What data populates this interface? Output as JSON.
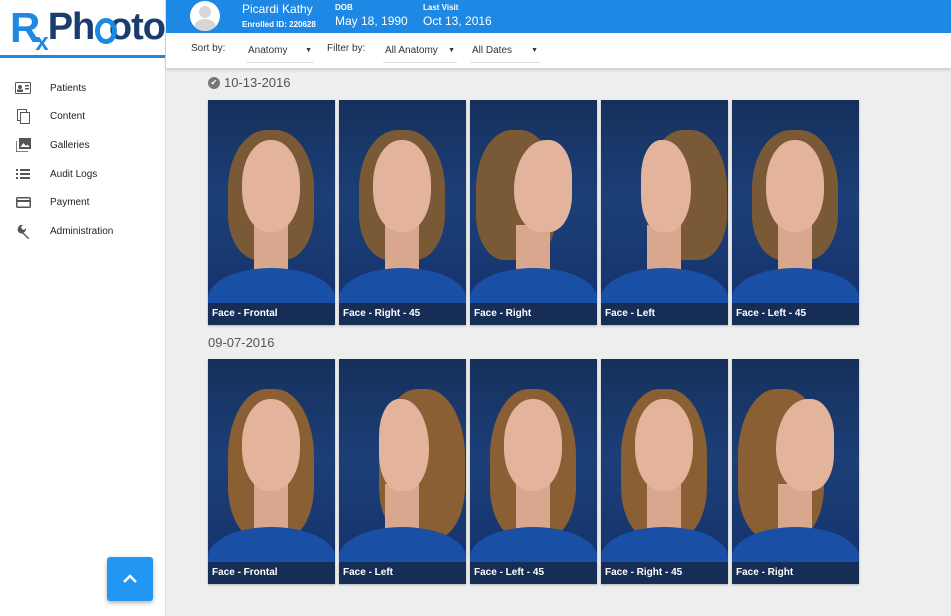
{
  "logo": {
    "rx": "R",
    "x": "x",
    "ph": "Ph",
    "oto": "oto"
  },
  "nav": [
    {
      "label": "Patients",
      "icon": "patients-icon"
    },
    {
      "label": "Content",
      "icon": "content-icon"
    },
    {
      "label": "Galleries",
      "icon": "galleries-icon"
    },
    {
      "label": "Audit Logs",
      "icon": "audit-logs-icon"
    },
    {
      "label": "Payment",
      "icon": "payment-icon"
    },
    {
      "label": "Administration",
      "icon": "wrench-icon"
    }
  ],
  "header": {
    "name": "Picardi Kathy",
    "enrolled": "Enrolled ID: 220628",
    "dob_label": "DOB",
    "dob": "May 18, 1990",
    "visit_label": "Last Visit",
    "visit": "Oct 13, 2016"
  },
  "toolbar": {
    "sort_label": "Sort by:",
    "sort_value": "Anatomy",
    "filter_label": "Filter by:",
    "filter_value": "All Anatomy",
    "dates_value": "All Dates"
  },
  "groups": [
    {
      "date": "10-13-2016",
      "checked": true,
      "photos": [
        {
          "caption": "Face - Frontal"
        },
        {
          "caption": "Face - Right - 45"
        },
        {
          "caption": "Face - Right"
        },
        {
          "caption": "Face - Left"
        },
        {
          "caption": "Face - Left - 45"
        }
      ]
    },
    {
      "date": "09-07-2016",
      "checked": false,
      "photos": [
        {
          "caption": "Face - Frontal"
        },
        {
          "caption": "Face - Left"
        },
        {
          "caption": "Face - Left - 45"
        },
        {
          "caption": "Face - Right - 45"
        },
        {
          "caption": "Face - Right"
        }
      ]
    }
  ],
  "colors": {
    "brand": "#1e88e5",
    "fab": "#2196f3",
    "hair_group1": "#7a5a36",
    "hair_group2": "#8a5f34"
  }
}
